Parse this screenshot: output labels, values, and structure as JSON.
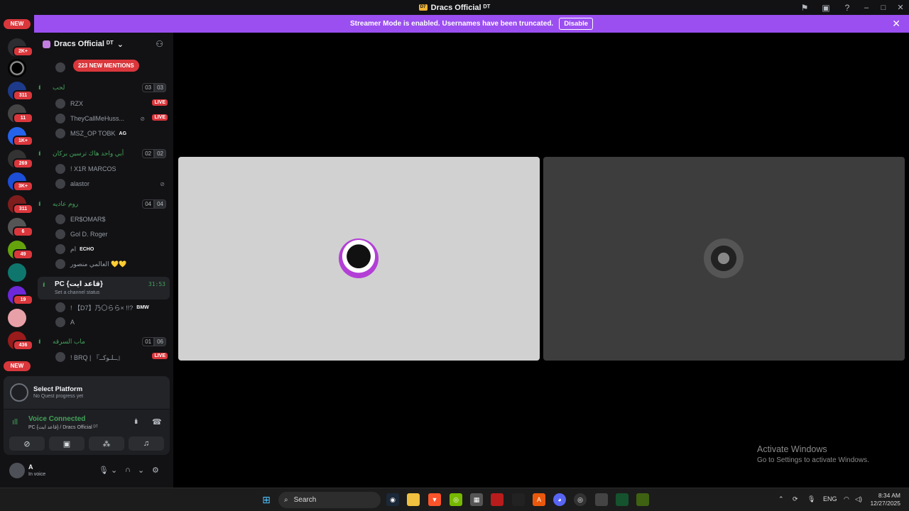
{
  "titlebar": {
    "title": "Dracs Official ᴰᵀ",
    "logo_text": "D7"
  },
  "banner": {
    "text": "Streamer Mode is enabled. Usernames have been truncated.",
    "disable_label": "Disable",
    "close": "✕"
  },
  "rail": {
    "new_top": "NEW",
    "new_bottom": "NEW",
    "badges": [
      "2K+",
      "311",
      "11",
      "1K+",
      "269",
      "3K+",
      "311",
      "6",
      "49",
      "19",
      "436"
    ]
  },
  "server": {
    "name": "Dracs Official ᴰᵀ",
    "mentions": "223 NEW MENTIONS"
  },
  "channels": [
    {
      "name": "لحب",
      "count_a": "03",
      "count_b": "03"
    },
    {
      "name": "أبي واحد هاك ترسين بركان",
      "count_a": "02",
      "count_b": "02"
    },
    {
      "name": "روم عاديه",
      "count_a": "04",
      "count_b": "04"
    },
    {
      "name": "ماب السرقه",
      "count_a": "01",
      "count_b": "06"
    }
  ],
  "users": {
    "u1": "RZX",
    "u2": "TheyCallMeHuss...",
    "u3": "MSZ_OP TOBK",
    "u3_tag": "AG",
    "u4": "! X1R MARCOS",
    "u5": "alastor",
    "u6": "ER$OMAR$",
    "u7": "Gol D. Roger",
    "u8": "ام",
    "u8_tag": "ECHO",
    "u9": "العالمي منصور 💛💛",
    "u10": "! 【D7】乃〇らら× !!?",
    "u10_tag": "BMW",
    "u11": "A",
    "u12": "! BRQ | 『ــلـوكــ』",
    "live": "LIVE"
  },
  "active_channel": {
    "name": "PC {قاعد ايت}",
    "status": "Set a channel status",
    "timer": "31:53"
  },
  "quest": {
    "title": "Select Platform",
    "subtitle": "No Quest progress yet"
  },
  "voice": {
    "status": "Voice Connected",
    "location": "PC {قاعد ايت} / Dracs Official ᴰᵀ"
  },
  "user": {
    "name": "A",
    "status": "In voice"
  },
  "watermark": {
    "line1": "Activate Windows",
    "line2": "Go to Settings to activate Windows."
  },
  "taskbar": {
    "search": "Search",
    "lang": "ENG",
    "time": "8:34 AM",
    "date": "12/27/2025"
  }
}
